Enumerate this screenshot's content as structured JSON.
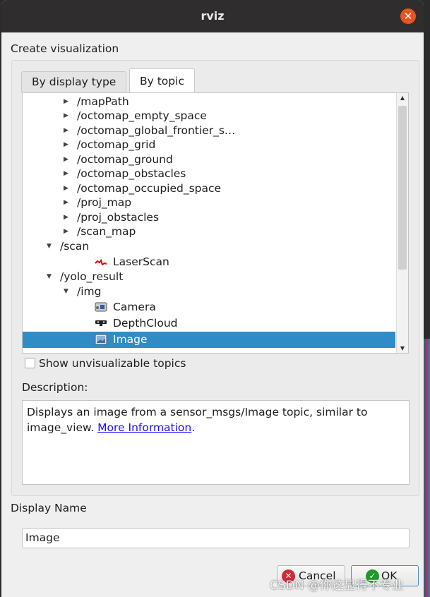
{
  "window": {
    "title": "rviz",
    "close_icon": "close-icon",
    "close_color": "#e9541f"
  },
  "heading": "Create visualization",
  "tabs": [
    {
      "label": "By display type",
      "active": false
    },
    {
      "label": "By topic",
      "active": true
    }
  ],
  "tree": [
    {
      "label": "/mapPath",
      "depth": 2,
      "expander": "collapsed"
    },
    {
      "label": "/octomap_empty_space",
      "depth": 2,
      "expander": "collapsed"
    },
    {
      "label": "/octomap_global_frontier_s…",
      "depth": 2,
      "expander": "collapsed"
    },
    {
      "label": "/octomap_grid",
      "depth": 2,
      "expander": "collapsed"
    },
    {
      "label": "/octomap_ground",
      "depth": 2,
      "expander": "collapsed"
    },
    {
      "label": "/octomap_obstacles",
      "depth": 2,
      "expander": "collapsed"
    },
    {
      "label": "/octomap_occupied_space",
      "depth": 2,
      "expander": "collapsed"
    },
    {
      "label": "/proj_map",
      "depth": 2,
      "expander": "collapsed"
    },
    {
      "label": "/proj_obstacles",
      "depth": 2,
      "expander": "collapsed"
    },
    {
      "label": "/scan_map",
      "depth": 2,
      "expander": "collapsed"
    },
    {
      "label": "/scan",
      "depth": 1,
      "expander": "expanded"
    },
    {
      "label": "LaserScan",
      "depth": 3,
      "icon": "laserscan-icon"
    },
    {
      "label": "/yolo_result",
      "depth": 1,
      "expander": "expanded"
    },
    {
      "label": "/img",
      "depth": 2,
      "expander": "expanded"
    },
    {
      "label": "Camera",
      "depth": 3,
      "icon": "camera-icon"
    },
    {
      "label": "DepthCloud",
      "depth": 3,
      "icon": "depthcloud-icon"
    },
    {
      "label": "Image",
      "depth": 3,
      "icon": "image-icon",
      "selected": true
    }
  ],
  "show_unvisualizable": {
    "label": "Show unvisualizable topics",
    "checked": false
  },
  "description": {
    "label": "Description:",
    "text": "Displays an image from a sensor_msgs/Image topic, similar to image_view. ",
    "link": "More Information",
    "after": "."
  },
  "display_name": {
    "label": "Display Name",
    "value": "Image"
  },
  "buttons": {
    "cancel": "Cancel",
    "ok": "OK"
  },
  "watermark": "CSDN @你这显得不专业",
  "selection_color": "#308cc6"
}
